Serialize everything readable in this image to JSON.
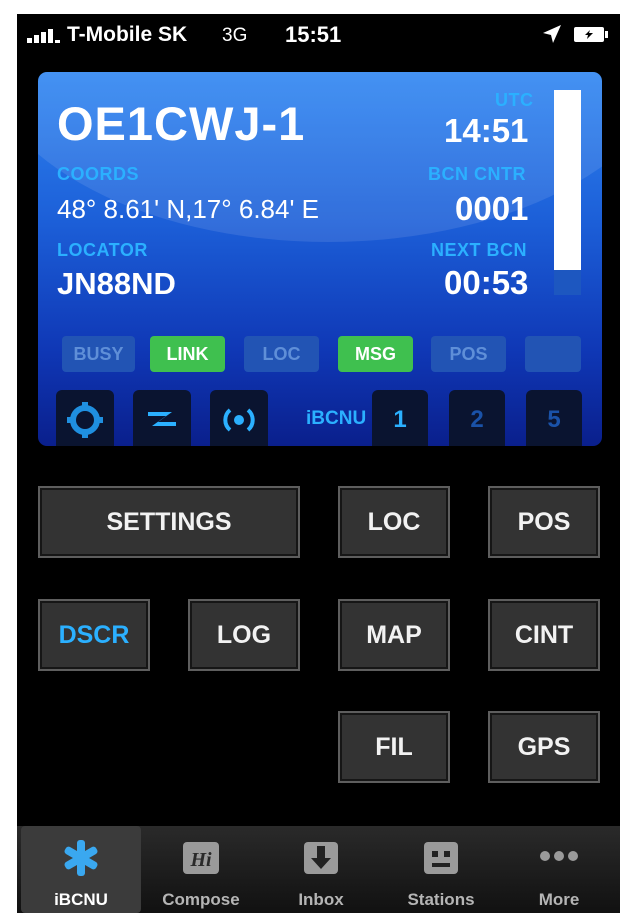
{
  "status_bar": {
    "carrier": "T-Mobile SK",
    "network": "3G",
    "time": "15:51"
  },
  "panel": {
    "callsign": "OE1CWJ-1",
    "utc_label": "UTC",
    "utc_time": "14:51",
    "coords_label": "COORDS",
    "coords_value": "48° 8.61' N,17° 6.84' E",
    "bcn_cntr_label": "BCN CNTR",
    "bcn_cntr_value": "0001",
    "locator_label": "LOCATOR",
    "locator_value": "JN88ND",
    "next_bcn_label": "NEXT BCN",
    "next_bcn_value": "00:53",
    "beacon_level": 0.88
  },
  "indicators": [
    {
      "label": "BUSY",
      "active": false
    },
    {
      "label": "LINK",
      "active": true
    },
    {
      "label": "LOC",
      "active": false
    },
    {
      "label": "MSG",
      "active": true
    },
    {
      "label": "POS",
      "active": false
    },
    {
      "label": "",
      "active": false
    }
  ],
  "mode_tabs": {
    "ibcnu_label": "iBCNU",
    "numbers": [
      "1",
      "2",
      "5"
    ],
    "icons": [
      "crosshair-icon",
      "lightning-icon",
      "broadcast-icon"
    ]
  },
  "buttons": {
    "settings": "SETTINGS",
    "loc": "LOC",
    "pos": "POS",
    "dscr": "DSCR",
    "log": "LOG",
    "map": "MAP",
    "cint": "CINT",
    "fil": "FIL",
    "gps": "GPS"
  },
  "tabbar": [
    {
      "label": "iBCNU",
      "icon": "asterisk-icon",
      "selected": true
    },
    {
      "label": "Compose",
      "icon": "compose-icon",
      "selected": false
    },
    {
      "label": "Inbox",
      "icon": "inbox-icon",
      "selected": false
    },
    {
      "label": "Stations",
      "icon": "stations-icon",
      "selected": false
    },
    {
      "label": "More",
      "icon": "more-icon",
      "selected": false
    }
  ],
  "colors": {
    "accent_blue": "#2bb0ff",
    "active_green": "#3fc04f",
    "panel_blue": "#1c5fd8"
  }
}
